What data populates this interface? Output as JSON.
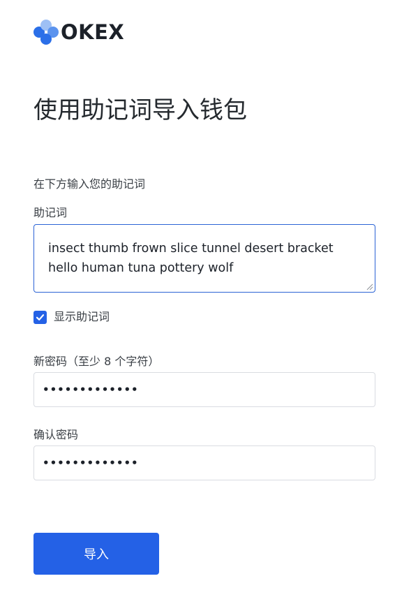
{
  "brand": {
    "name": "OKEX",
    "mark_colors": [
      "#2b6fe8",
      "#5b93ee",
      "#9ec0f5",
      "#2b6fe8"
    ]
  },
  "page": {
    "title": "使用助记词导入钱包",
    "instruction": "在下方输入您的助记词"
  },
  "mnemonic": {
    "label": "助记词",
    "value": "insect thumb frown slice tunnel desert bracket hello human tuna pottery wolf",
    "show_label": "显示助记词",
    "show_checked": true
  },
  "new_password": {
    "label": "新密码（至少 8 个字符）",
    "value": "•••••••••••••"
  },
  "confirm_password": {
    "label": "确认密码",
    "value": "•••••••••••••"
  },
  "submit": {
    "label": "导入"
  },
  "colors": {
    "accent": "#2461e6",
    "input_border": "#d9dce1",
    "focus_border": "#2b63d5"
  },
  "icons": {
    "logo": "okex-logo-icon",
    "checkbox": "checkmark-icon",
    "resize": "resize-grip-icon"
  }
}
